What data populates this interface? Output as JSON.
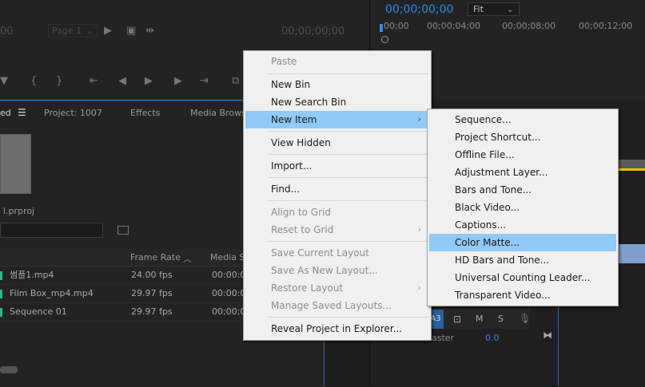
{
  "source_monitor": {
    "timecode_left": "00",
    "page_select": "Page 1",
    "timecode_right": "00;00;00;00"
  },
  "program_monitor": {
    "timecode": "00;00;00;00",
    "fit_select": "Fit",
    "ruler_ticks": [
      "00;00",
      "00;00;04;00",
      "00;00;08;00",
      "00;00;12;00"
    ]
  },
  "project_panel": {
    "tabs": [
      "ed",
      "Project: 1007",
      "Effects",
      "Media Browse"
    ],
    "project_file": "l.prproj",
    "columns": [
      "Frame Rate",
      "Media S"
    ],
    "rows": [
      {
        "name": "썸플1.mp4",
        "fps": "24.00 fps",
        "start": "00:00:00"
      },
      {
        "name": "Film Box_mp4.mp4",
        "fps": "29.97 fps",
        "start": "00:00:00"
      },
      {
        "name": "Sequence 01",
        "fps": "29.97 fps",
        "start": "00;00;00"
      }
    ]
  },
  "timeline": {
    "track_label": "A3",
    "master_label": "aster",
    "master_value": "0.0",
    "track_buttons": [
      "M",
      "S"
    ]
  },
  "context_menu": {
    "items": [
      {
        "label": "Paste",
        "disabled": true
      },
      {
        "label": "New Bin"
      },
      {
        "label": "New Search Bin"
      },
      {
        "label": "New Item",
        "highlighted": true,
        "submenu": true
      },
      {
        "label": "View Hidden"
      },
      {
        "label": "Import..."
      },
      {
        "label": "Find..."
      },
      {
        "label": "Align to Grid",
        "disabled": true
      },
      {
        "label": "Reset to Grid",
        "disabled": true,
        "submenu": true
      },
      {
        "label": "Save Current Layout",
        "disabled": true
      },
      {
        "label": "Save As New Layout...",
        "disabled": true
      },
      {
        "label": "Restore Layout",
        "disabled": true,
        "submenu": true
      },
      {
        "label": "Manage Saved Layouts...",
        "disabled": true
      },
      {
        "label": "Reveal Project in Explorer..."
      }
    ]
  },
  "submenu": {
    "items": [
      {
        "label": "Sequence..."
      },
      {
        "label": "Project Shortcut..."
      },
      {
        "label": "Offline File..."
      },
      {
        "label": "Adjustment Layer..."
      },
      {
        "label": "Bars and Tone..."
      },
      {
        "label": "Black Video..."
      },
      {
        "label": "Captions..."
      },
      {
        "label": "Color Matte...",
        "highlighted": true
      },
      {
        "label": "HD Bars and Tone..."
      },
      {
        "label": "Universal Counting Leader..."
      },
      {
        "label": "Transparent Video..."
      }
    ]
  },
  "colors": {
    "accent_blue": "#2d8ceb",
    "menu_highlight": "#91c9f7",
    "menu_bg": "#f0f0f0"
  }
}
